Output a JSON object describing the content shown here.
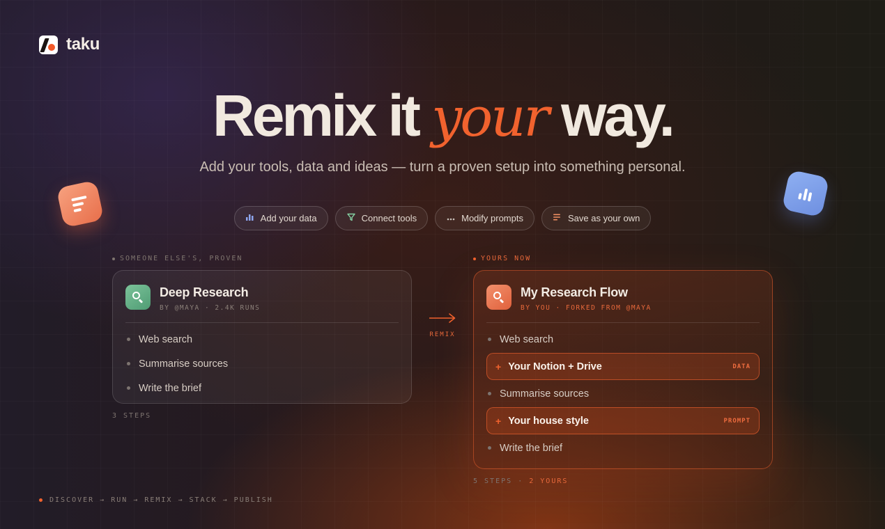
{
  "brand": {
    "name": "taku"
  },
  "hero": {
    "title_start": "Remix it",
    "title_accent": "your",
    "title_end": "way.",
    "subtitle": "Add your tools, data and ideas — turn a proven setup into something personal."
  },
  "pills": [
    {
      "label": "Add your data",
      "icon": "bar-chart-icon",
      "icon_color": "#8ea6ee"
    },
    {
      "label": "Connect tools",
      "icon": "funnel-icon",
      "icon_color": "#86d3a4"
    },
    {
      "label": "Modify prompts",
      "icon": "dots-icon",
      "icon_color": "#c9c2bb"
    },
    {
      "label": "Save as your own",
      "icon": "lines-icon",
      "icon_color": "#f08f62"
    }
  ],
  "original": {
    "eyebrow": "SOMEONE ELSE'S, PROVEN",
    "title": "Deep Research",
    "meta": "BY @MAYA · 2.4K RUNS",
    "icon": "search-icon",
    "steps": [
      "Web search",
      "Summarise sources",
      "Write the brief"
    ],
    "footer": "3 STEPS"
  },
  "remix": {
    "label": "REMIX",
    "accent_color": "#f1622e"
  },
  "yours": {
    "eyebrow": "YOURS NOW",
    "title": "My Research Flow",
    "meta": "BY YOU · FORKED FROM @MAYA",
    "icon": "search-icon",
    "steps": [
      {
        "label": "Web search",
        "added": false
      },
      {
        "label": "Your Notion + Drive",
        "added": true,
        "tag": "DATA"
      },
      {
        "label": "Summarise sources",
        "added": false
      },
      {
        "label": "Your house style",
        "added": true,
        "tag": "PROMPT"
      },
      {
        "label": "Write the brief",
        "added": false
      }
    ],
    "footer_steps": "5 STEPS",
    "footer_sep": "·",
    "footer_yours": "2 YOURS"
  },
  "journey": "DISCOVER → RUN → REMIX → STACK → PUBLISH"
}
